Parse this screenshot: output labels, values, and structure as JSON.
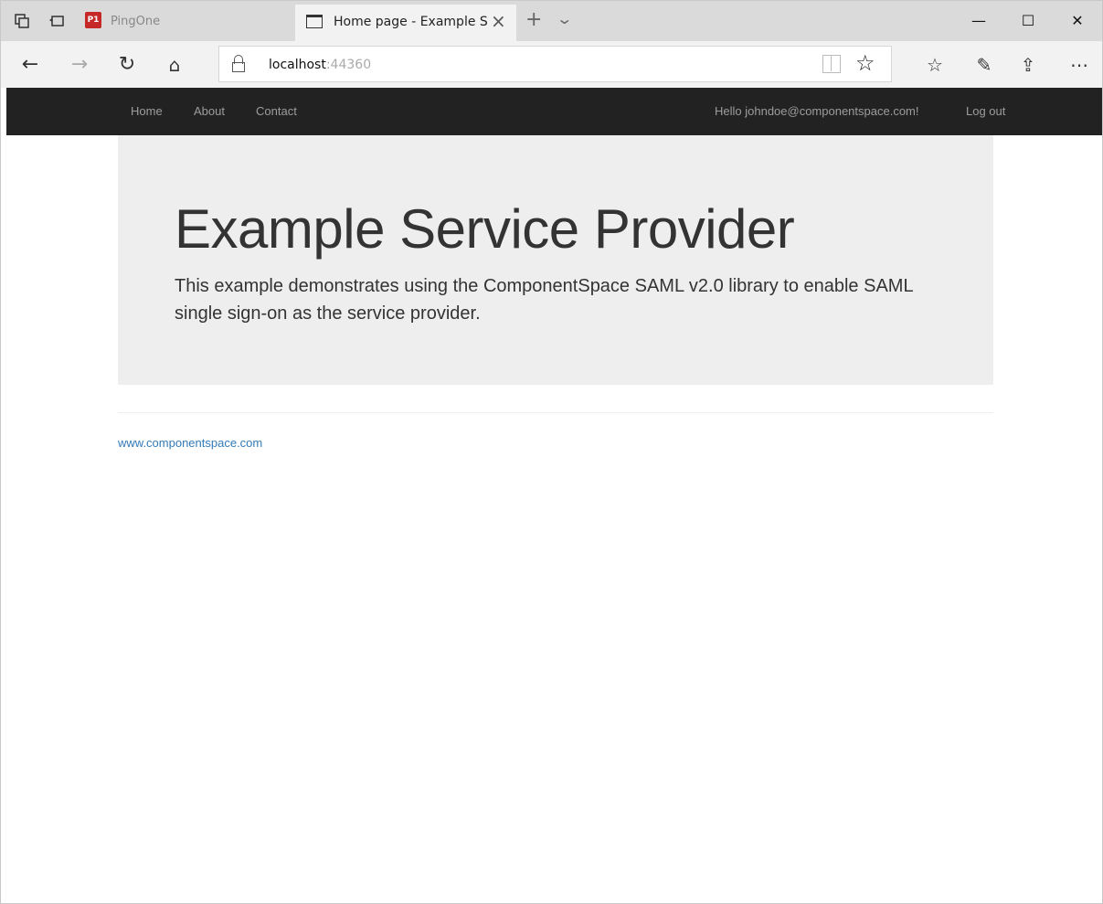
{
  "browser": {
    "tabs": [
      {
        "title": "PingOne",
        "favicon_text": "P1",
        "active": false
      },
      {
        "title": "Home page - Example S",
        "active": true
      }
    ],
    "window_controls": {
      "minimize": "—",
      "maximize": "☐",
      "close": "✕"
    },
    "address": {
      "host": "localhost",
      "port": ":44360"
    }
  },
  "site": {
    "nav": {
      "links": [
        "Home",
        "About",
        "Contact"
      ],
      "greeting": "Hello johndoe@componentspace.com!",
      "logout": "Log out"
    },
    "jumbotron": {
      "heading": "Example Service Provider",
      "lead": "This example demonstrates using the ComponentSpace SAML v2.0 library to enable SAML single sign-on as the service provider."
    },
    "footer": {
      "link": "www.componentspace.com"
    }
  },
  "colors": {
    "navbar_bg": "#222222",
    "nav_link": "#9d9d9d",
    "jumbotron_bg": "#eeeeee",
    "link": "#337ab7"
  }
}
